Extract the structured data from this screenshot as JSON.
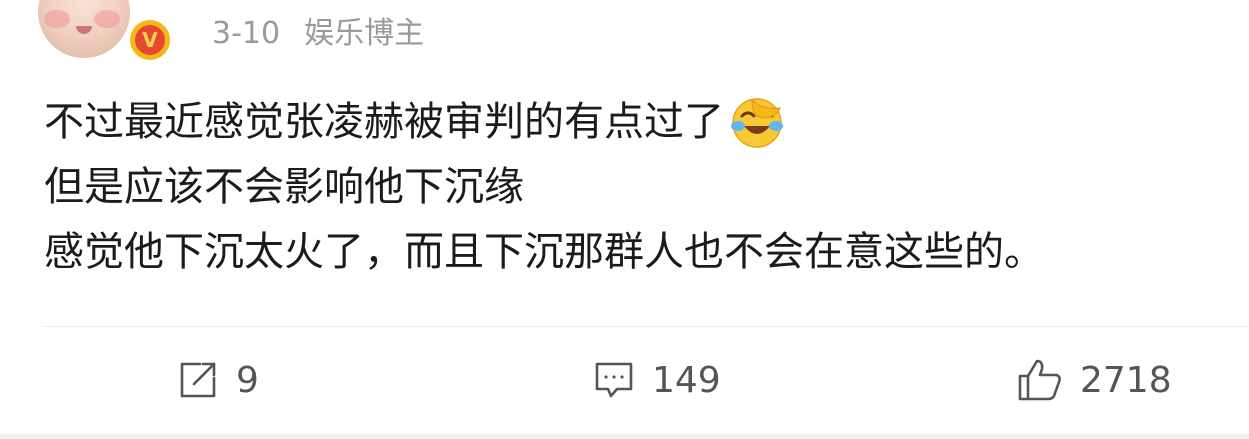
{
  "post": {
    "date": "3-10",
    "author_tag": "娱乐博主",
    "verified_badge_letter": "V",
    "content_lines": [
      "不过最近感觉张凌赫被审判的有点过了",
      "但是应该不会影响他下沉缘",
      "感觉他下沉太火了，而且下沉那群人也不会在意这些的。"
    ],
    "emoji": "laughing-crying-emoji"
  },
  "actions": {
    "share_count": "9",
    "comment_count": "149",
    "like_count": "2718"
  },
  "colors": {
    "meta_text": "#9a9a9a",
    "body_text": "#1b1b1b",
    "badge_outer": "#f6b817",
    "badge_inner": "#e5492f",
    "action_icon": "#555555"
  },
  "icons": {
    "share": "share-icon",
    "comment": "comment-icon",
    "like": "thumbs-up-icon",
    "verified": "verified-badge-icon"
  }
}
